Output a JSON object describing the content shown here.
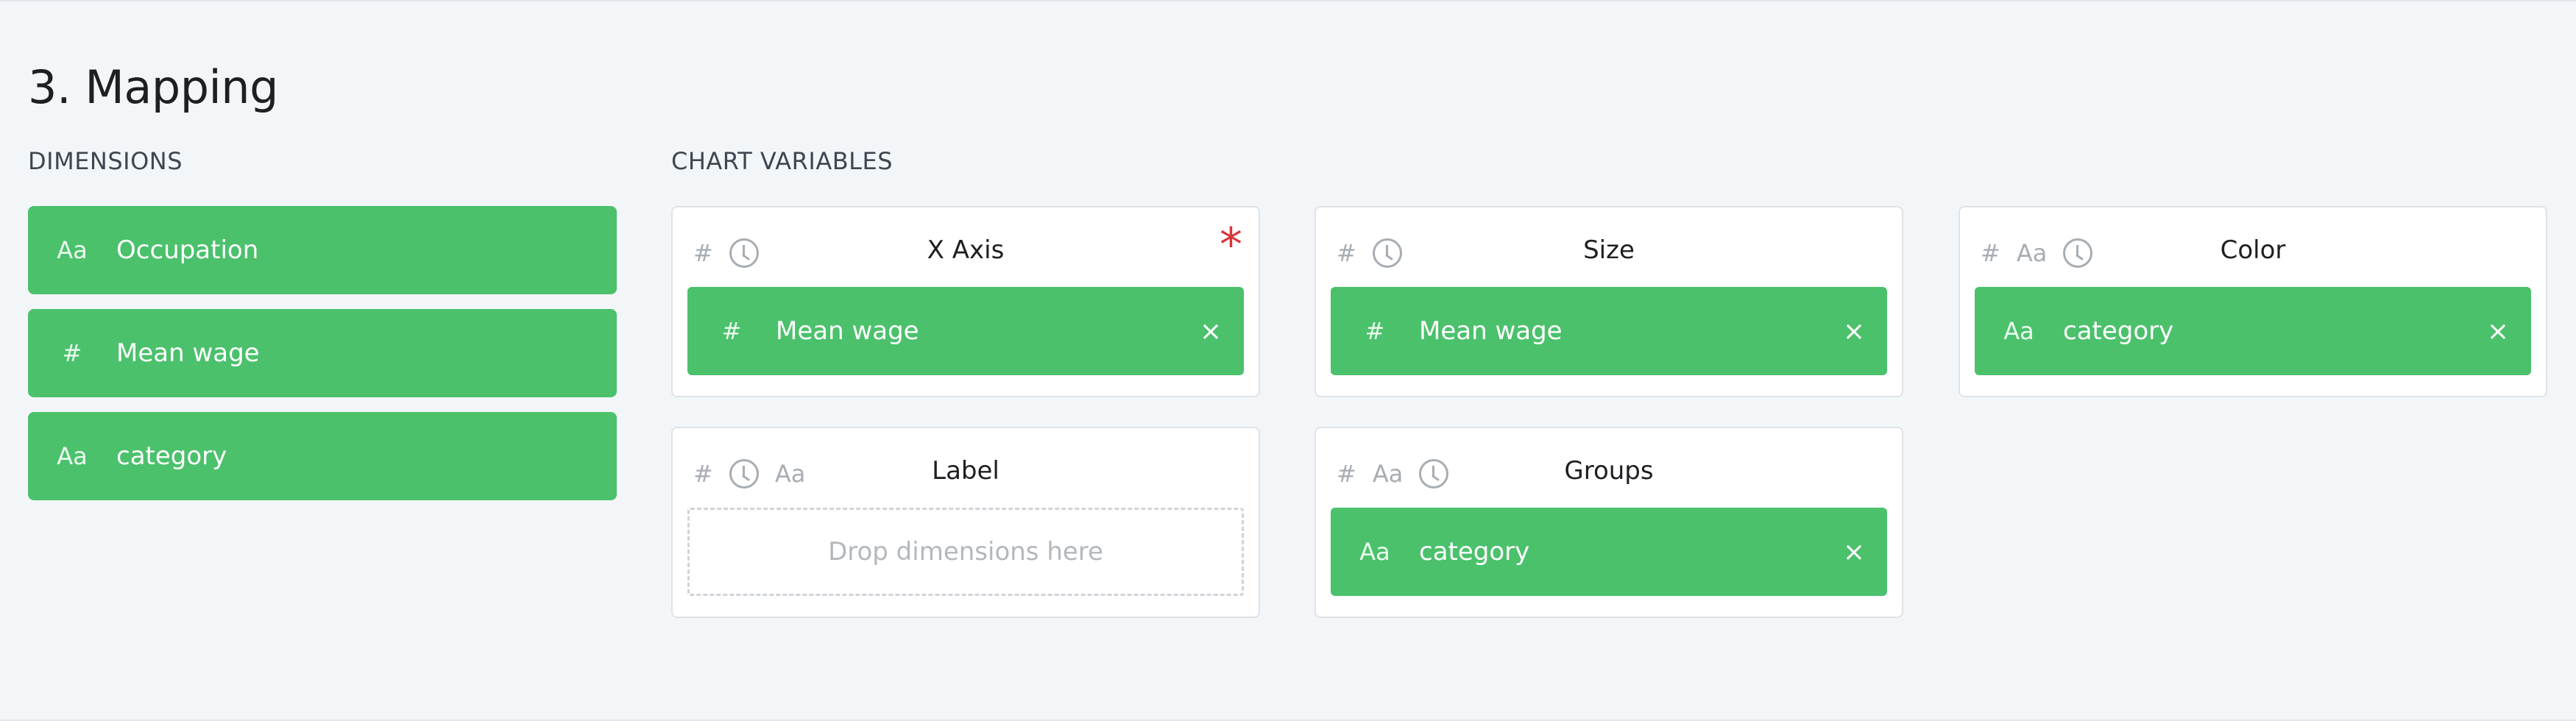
{
  "page": {
    "title": "3. Mapping"
  },
  "dimensions": {
    "heading": "DIMENSIONS",
    "items": [
      {
        "type": "Aa",
        "label": "Occupation"
      },
      {
        "type": "#",
        "label": "Mean wage"
      },
      {
        "type": "Aa",
        "label": "category"
      }
    ]
  },
  "chart_variables": {
    "heading": "CHART VARIABLES",
    "x_axis": {
      "title": "X Axis",
      "types": [
        "#"
      ],
      "required_mark": "*",
      "assigned": {
        "type": "#",
        "label": "Mean wage",
        "remove": "×"
      }
    },
    "size": {
      "title": "Size",
      "types": [
        "#"
      ],
      "assigned": {
        "type": "#",
        "label": "Mean wage",
        "remove": "×"
      }
    },
    "color": {
      "title": "Color",
      "types": [
        "#",
        "Aa"
      ],
      "assigned": {
        "type": "Aa",
        "label": "category",
        "remove": "×"
      }
    },
    "label": {
      "title": "Label",
      "types": [
        "#",
        "Aa"
      ],
      "placeholder": "Drop dimensions here"
    },
    "groups": {
      "title": "Groups",
      "types": [
        "#",
        "Aa"
      ],
      "assigned": {
        "type": "Aa",
        "label": "category",
        "remove": "×"
      }
    }
  },
  "colors": {
    "pill": "#4bc16c",
    "required": "#d8343a",
    "background": "#f3f6f9"
  }
}
